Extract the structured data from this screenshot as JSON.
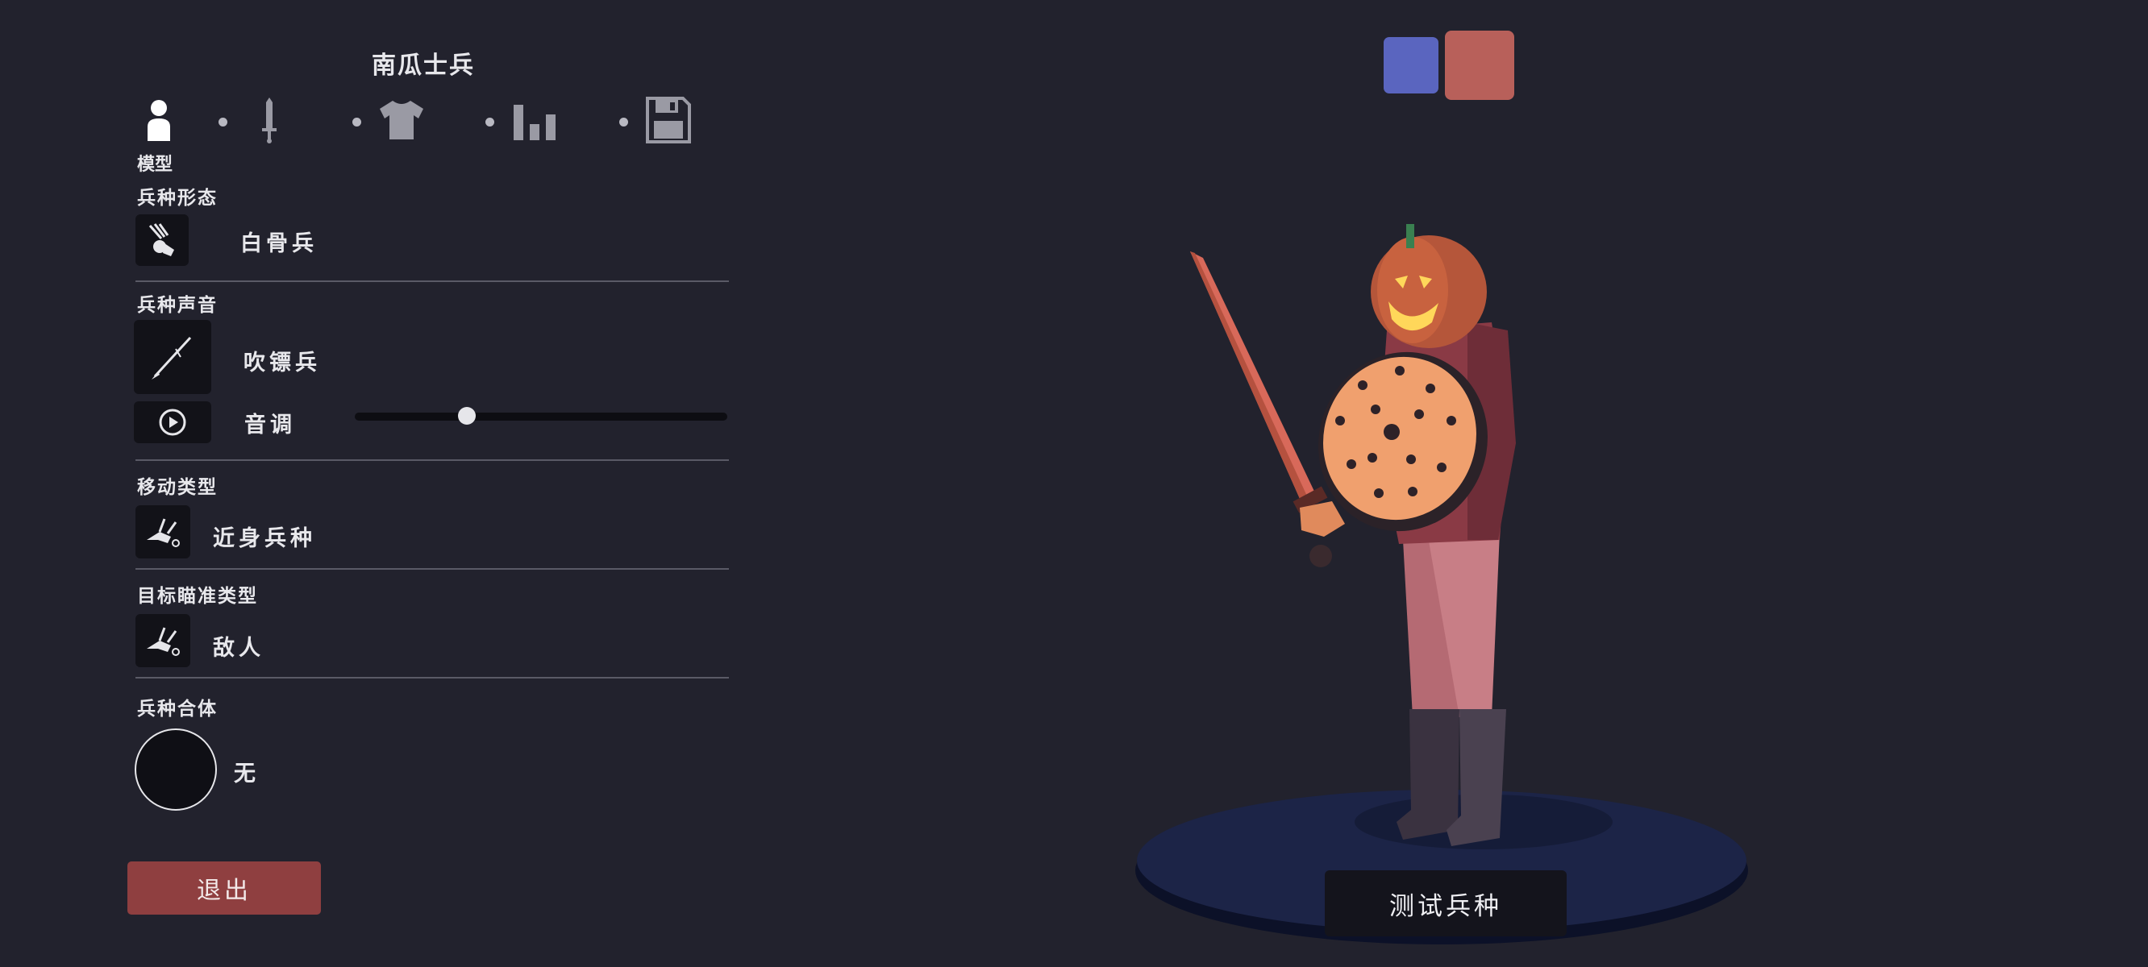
{
  "unit_name": "南瓜士兵",
  "tabs": [
    {
      "name": "model",
      "icon": "person-icon",
      "active": true
    },
    {
      "name": "weapon",
      "icon": "sword-icon",
      "active": false
    },
    {
      "name": "clothing",
      "icon": "shirt-icon",
      "active": false
    },
    {
      "name": "stats",
      "icon": "bar-chart-icon",
      "active": false
    },
    {
      "name": "save",
      "icon": "floppy-disk-icon",
      "active": false
    }
  ],
  "active_tab_label": "模型",
  "sections": {
    "form": {
      "heading": "兵种形态",
      "value": "白骨兵",
      "icon": "skeleton-unit-icon"
    },
    "voice": {
      "heading": "兵种声音",
      "value": "吹镖兵",
      "icon": "blowdart-icon",
      "pitch_label": "音调",
      "pitch_value": 0.3,
      "play_icon": "play-icon"
    },
    "movement": {
      "heading": "移动类型",
      "value": "近身兵种",
      "icon": "melee-unit-icon"
    },
    "targeting": {
      "heading": "目标瞄准类型",
      "value": "敌人",
      "icon": "target-enemy-icon"
    },
    "merge": {
      "heading": "兵种合体",
      "value": "无"
    }
  },
  "exit_label": "退出",
  "test_label": "测试兵种",
  "team_colors": {
    "blue": "#5a65bf",
    "red": "#b8605a"
  }
}
